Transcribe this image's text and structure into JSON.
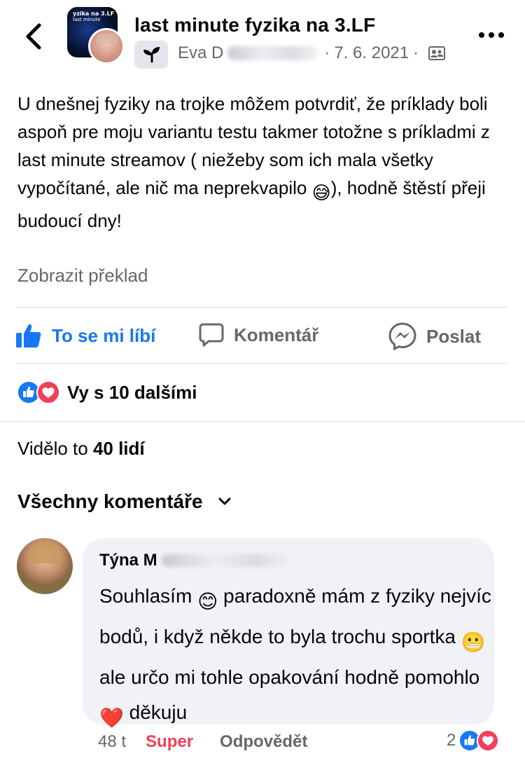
{
  "header": {
    "group_name": "last minute fyzika na 3.LF",
    "group_thumb_line1": "yzika na 3.LF",
    "group_thumb_line2": "last minute",
    "author_visible": "Eva D",
    "separator": "·",
    "date": "7. 6. 2021"
  },
  "post": {
    "text_1": "U dnešnej fyziky na trojke môžem potvrdiť, že príklady boli aspoň pre moju variantu testu takmer totožne s príkladmi z last minute streamov ( niežeby som ich mala všetky vypočítané, ale nič ma neprekvapilo ",
    "emoji_1": "😅",
    "text_2": "), hodně štěstí přeji budoucí dny!",
    "translate_label": "Zobrazit překlad"
  },
  "actions": {
    "like_label": "To se mi líbí",
    "comment_label": "Komentář",
    "share_label": "Poslat"
  },
  "reactions": {
    "summary": "Vy s 10 dalšími"
  },
  "seen": {
    "prefix": "Vidělo to ",
    "count": "40 lidí"
  },
  "comments_header": {
    "label": "Všechny komentáře"
  },
  "comment": {
    "author_visible": "Týna M",
    "seg_1": "Souhlasím ",
    "emoji_1": "😊",
    "seg_2": " paradoxně mám z fyziky nejvíc bodů, i když někde to byla trochu sportka ",
    "emoji_2": "😬",
    "seg_3": " ale určo mi tohle opakování hodně pomohlo ",
    "emoji_3": "❤️",
    "seg_4": " děkuju",
    "time": "48 t",
    "super_label": "Super",
    "reply_label": "Odpovědět",
    "reaction_count": "2"
  },
  "colors": {
    "facebook_blue": "#1877f2",
    "love_red": "#f33e58",
    "secondary_text": "#65676b",
    "bubble_bg": "#f0f2f5"
  },
  "icons": [
    "back-arrow-icon",
    "more-icon",
    "sprout-icon",
    "audience-members-icon",
    "like-thumb-icon",
    "comment-icon",
    "messenger-icon",
    "like-reaction-icon",
    "love-reaction-icon",
    "chevron-down-icon"
  ]
}
